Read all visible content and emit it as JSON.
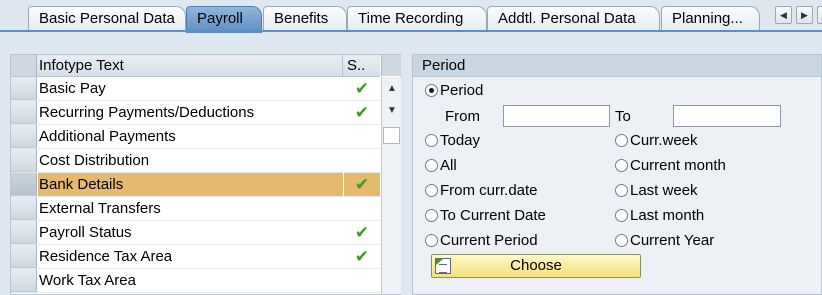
{
  "tabs": [
    {
      "label": "Basic Personal Data",
      "active": false
    },
    {
      "label": "Payroll",
      "active": true
    },
    {
      "label": "Benefits",
      "active": false
    },
    {
      "label": "Time Recording",
      "active": false
    },
    {
      "label": "Addtl. Personal Data",
      "active": false
    },
    {
      "label": "Planning...",
      "active": false
    }
  ],
  "tab_nav": {
    "prev_icon": "triangle-left-icon",
    "next_icon": "triangle-right-icon"
  },
  "infotype_table": {
    "columns": {
      "text": "Infotype Text",
      "status": "S.."
    },
    "rows": [
      {
        "text": "Basic Pay",
        "status": "✔",
        "selected": false
      },
      {
        "text": "Recurring Payments/Deductions",
        "status": "✔",
        "selected": false
      },
      {
        "text": "Additional Payments",
        "status": "",
        "selected": false
      },
      {
        "text": "Cost Distribution",
        "status": "",
        "selected": false
      },
      {
        "text": "Bank Details",
        "status": "✔",
        "selected": true
      },
      {
        "text": "External Transfers",
        "status": "",
        "selected": false
      },
      {
        "text": "Payroll Status",
        "status": "✔",
        "selected": false
      },
      {
        "text": "Residence Tax Area",
        "status": "✔",
        "selected": false
      },
      {
        "text": "Work Tax Area",
        "status": "",
        "selected": false
      }
    ],
    "status_color": "#3d9b25",
    "selected_color": "#e4ba6e"
  },
  "period": {
    "title": "Period",
    "options": {
      "period": "Period",
      "today": "Today",
      "all": "All",
      "from_curr_date": "From curr.date",
      "to_current_date": "To Current Date",
      "current_period": "Current Period",
      "curr_week": "Curr.week",
      "current_month": "Current month",
      "last_week": "Last week",
      "last_month": "Last month",
      "current_year": "Current Year"
    },
    "selected": "period",
    "from_label": "From",
    "to_label": "To",
    "from_value": "",
    "to_value": "",
    "choose_label": "Choose",
    "choose_color": "#f5e27a"
  }
}
